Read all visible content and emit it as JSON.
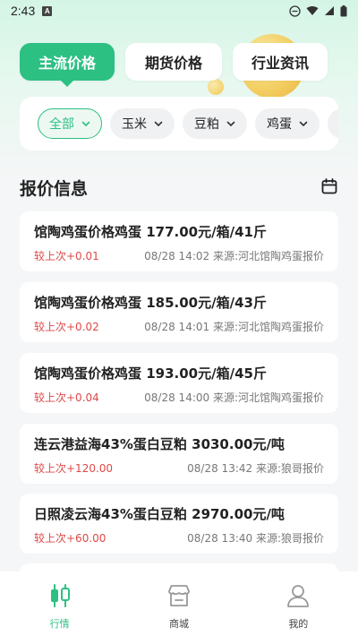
{
  "status_bar": {
    "time": "2:43",
    "notification": "A"
  },
  "top_tabs": [
    {
      "label": "主流价格",
      "active": true
    },
    {
      "label": "期货价格",
      "active": false
    },
    {
      "label": "行业资讯",
      "active": false
    }
  ],
  "filters": [
    {
      "label": "全部",
      "active": true
    },
    {
      "label": "玉米",
      "active": false
    },
    {
      "label": "豆粕",
      "active": false
    },
    {
      "label": "鸡蛋",
      "active": false
    }
  ],
  "section": {
    "title": "报价信息",
    "icon": "calendar-icon"
  },
  "quotes": [
    {
      "title": "馆陶鸡蛋价格鸡蛋 177.00元/箱/41斤",
      "change": "较上次+0.01",
      "meta": "08/28 14:02 来源:河北馆陶鸡蛋报价"
    },
    {
      "title": "馆陶鸡蛋价格鸡蛋 185.00元/箱/43斤",
      "change": "较上次+0.02",
      "meta": "08/28 14:01 来源:河北馆陶鸡蛋报价"
    },
    {
      "title": "馆陶鸡蛋价格鸡蛋 193.00元/箱/45斤",
      "change": "较上次+0.04",
      "meta": "08/28 14:00 来源:河北馆陶鸡蛋报价"
    },
    {
      "title": "连云港益海43%蛋白豆粕 3030.00元/吨",
      "change": "较上次+120.00",
      "meta": "08/28 13:42 来源:狼哥报价"
    },
    {
      "title": "日照凌云海43%蛋白豆粕 2970.00元/吨",
      "change": "较上次+60.00",
      "meta": "08/28 13:40 来源:狼哥报价"
    }
  ],
  "bottom_nav": [
    {
      "label": "行情",
      "icon": "candlestick-chart-icon",
      "active": true
    },
    {
      "label": "商城",
      "icon": "store-icon",
      "active": false
    },
    {
      "label": "我的",
      "icon": "user-icon",
      "active": false
    }
  ],
  "colors": {
    "accent": "#2cc083",
    "up": "#e04848"
  }
}
